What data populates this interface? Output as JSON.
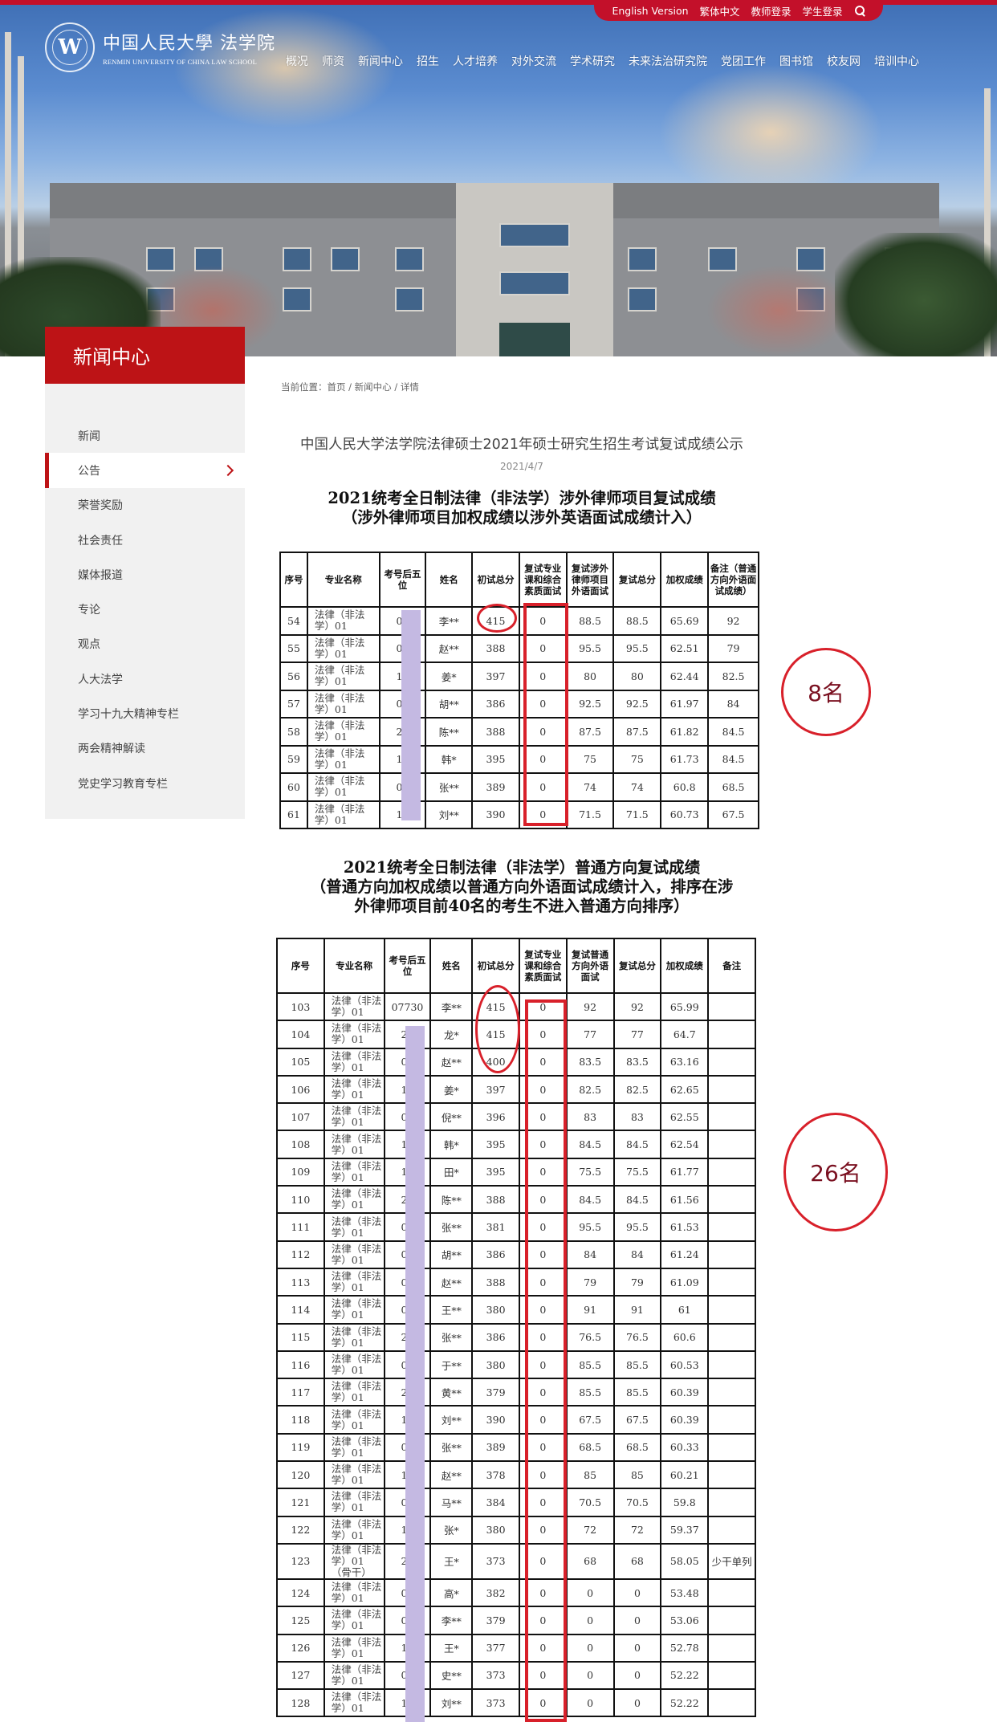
{
  "topbar": {
    "links": [
      "English Version",
      "繁体中文",
      "教师登录",
      "学生登录"
    ],
    "search_icon": "search-icon"
  },
  "logo": {
    "seal_letter": "W",
    "name_cn": "中国人民大學 法学院",
    "name_en": "RENMIN UNIVERSITY OF CHINA LAW SCHOOL"
  },
  "nav": {
    "items": [
      "概况",
      "师资",
      "新闻中心",
      "招生",
      "人才培养",
      "对外交流",
      "学术研究",
      "未来法治研究院",
      "党团工作",
      "图书馆",
      "校友网",
      "培训中心"
    ]
  },
  "sidebar": {
    "title": "新闻中心",
    "active_index": 1,
    "items": [
      "新闻",
      "公告",
      "荣誉奖励",
      "社会责任",
      "媒体报道",
      "专论",
      "观点",
      "人大法学",
      "学习十九大精神专栏",
      "两会精神解读",
      "党史学习教育专栏"
    ]
  },
  "breadcrumb": {
    "text": "当前位置：首页 / 新闻中心 / 详情"
  },
  "article": {
    "title": "中国人民大学法学院法律硕士2021年硕士研究生招生考试复试成绩公示",
    "date": "2021/4/7"
  },
  "table1": {
    "title_line1": "2021统考全日制法律（非法学）涉外律师项目复试成绩",
    "title_line2": "（涉外律师项目加权成绩以涉外英语面试成绩计入）",
    "headers": [
      "序号",
      "专业名称",
      "考号后五位",
      "姓名",
      "初试总分",
      "复试专业课和综合素质面试",
      "复试涉外律师项目外语面试",
      "复试总分",
      "加权成绩",
      "备注（普通方向外语面试成绩）"
    ],
    "rows": [
      [
        "54",
        "法律（非法学）01",
        "07",
        "李**",
        "415",
        "0",
        "88.5",
        "88.5",
        "65.69",
        "92"
      ],
      [
        "55",
        "法律（非法学）01",
        "07",
        "赵**",
        "388",
        "0",
        "95.5",
        "95.5",
        "62.51",
        "79"
      ],
      [
        "56",
        "法律（非法学）01",
        "13",
        "姜*",
        "397",
        "0",
        "80",
        "80",
        "62.44",
        "82.5"
      ],
      [
        "57",
        "法律（非法学）01",
        "07",
        "胡**",
        "386",
        "0",
        "92.5",
        "92.5",
        "61.97",
        "84"
      ],
      [
        "58",
        "法律（非法学）01",
        "20",
        "陈**",
        "388",
        "0",
        "87.5",
        "87.5",
        "61.82",
        "84.5"
      ],
      [
        "59",
        "法律（非法学）01",
        "12",
        "韩*",
        "395",
        "0",
        "75",
        "75",
        "61.73",
        "84.5"
      ],
      [
        "60",
        "法律（非法学）01",
        "09",
        "张**",
        "389",
        "0",
        "74",
        "74",
        "60.8",
        "68.5"
      ],
      [
        "61",
        "法律（非法学）01",
        "17",
        "刘**",
        "390",
        "0",
        "71.5",
        "71.5",
        "60.73",
        "67.5"
      ]
    ],
    "annotation": "8名"
  },
  "table2": {
    "title_line1": "2021统考全日制法律（非法学）普通方向复试成绩",
    "title_line2": "（普通方向加权成绩以普通方向外语面试成绩计入，排序在涉",
    "title_line3": "外律师项目前40名的考生不进入普通方向排序）",
    "headers": [
      "序号",
      "专业名称",
      "考号后五位",
      "姓名",
      "初试总分",
      "复试专业课和综合素质面试",
      "复试普通方向外语面试",
      "复试总分",
      "加权成绩",
      "备注"
    ],
    "rows": [
      [
        "103",
        "法律（非法学）01",
        "07730",
        "李**",
        "415",
        "0",
        "92",
        "92",
        "65.99",
        ""
      ],
      [
        "104",
        "法律（非法学）01",
        "23",
        "龙*",
        "415",
        "0",
        "77",
        "77",
        "64.7",
        ""
      ],
      [
        "105",
        "法律（非法学）01",
        "09",
        "赵**",
        "400",
        "0",
        "83.5",
        "83.5",
        "63.16",
        ""
      ],
      [
        "106",
        "法律（非法学）01",
        "13",
        "姜*",
        "397",
        "0",
        "82.5",
        "82.5",
        "62.65",
        ""
      ],
      [
        "107",
        "法律（非法学）01",
        "07",
        "倪**",
        "396",
        "0",
        "83",
        "83",
        "62.55",
        ""
      ],
      [
        "108",
        "法律（非法学）01",
        "12",
        "韩*",
        "395",
        "0",
        "84.5",
        "84.5",
        "62.54",
        ""
      ],
      [
        "109",
        "法律（非法学）01",
        "17",
        "田*",
        "395",
        "0",
        "75.5",
        "75.5",
        "61.77",
        ""
      ],
      [
        "110",
        "法律（非法学）01",
        "20",
        "陈**",
        "388",
        "0",
        "84.5",
        "84.5",
        "61.56",
        ""
      ],
      [
        "111",
        "法律（非法学）01",
        "07",
        "张**",
        "381",
        "0",
        "95.5",
        "95.5",
        "61.53",
        ""
      ],
      [
        "112",
        "法律（非法学）01",
        "07",
        "胡**",
        "386",
        "0",
        "84",
        "84",
        "61.24",
        ""
      ],
      [
        "113",
        "法律（非法学）01",
        "07",
        "赵**",
        "388",
        "0",
        "79",
        "79",
        "61.09",
        ""
      ],
      [
        "114",
        "法律（非法学）01",
        "07",
        "王**",
        "380",
        "0",
        "91",
        "91",
        "61",
        ""
      ],
      [
        "115",
        "法律（非法学）01",
        "24",
        "张**",
        "386",
        "0",
        "76.5",
        "76.5",
        "60.6",
        ""
      ],
      [
        "116",
        "法律（非法学）01",
        "08",
        "于**",
        "380",
        "0",
        "85.5",
        "85.5",
        "60.53",
        ""
      ],
      [
        "117",
        "法律（非法学）01",
        "20",
        "黄**",
        "379",
        "0",
        "85.5",
        "85.5",
        "60.39",
        ""
      ],
      [
        "118",
        "法律（非法学）01",
        "17",
        "刘**",
        "390",
        "0",
        "67.5",
        "67.5",
        "60.39",
        ""
      ],
      [
        "119",
        "法律（非法学）01",
        "09",
        "张**",
        "389",
        "0",
        "68.5",
        "68.5",
        "60.33",
        ""
      ],
      [
        "120",
        "法律（非法学）01",
        "17",
        "赵**",
        "378",
        "0",
        "85",
        "85",
        "60.21",
        ""
      ],
      [
        "121",
        "法律（非法学）01",
        "07",
        "马**",
        "384",
        "0",
        "70.5",
        "70.5",
        "59.8",
        ""
      ],
      [
        "122",
        "法律（非法学）01",
        "18",
        "张*",
        "380",
        "0",
        "72",
        "72",
        "59.37",
        ""
      ],
      [
        "123",
        "法律（非法学）01（骨干）",
        "24",
        "王*",
        "373",
        "0",
        "68",
        "68",
        "58.05",
        "少干单列"
      ],
      [
        "124",
        "法律（非法学）01",
        "07",
        "高*",
        "382",
        "0",
        "0",
        "0",
        "53.48",
        ""
      ],
      [
        "125",
        "法律（非法学）01",
        "07",
        "李**",
        "379",
        "0",
        "0",
        "0",
        "53.06",
        ""
      ],
      [
        "126",
        "法律（非法学）01",
        "10",
        "王*",
        "377",
        "0",
        "0",
        "0",
        "52.78",
        ""
      ],
      [
        "127",
        "法律（非法学）01",
        "07",
        "史**",
        "373",
        "0",
        "0",
        "0",
        "52.22",
        ""
      ],
      [
        "128",
        "法律（非法学）01",
        "17",
        "刘**",
        "373",
        "0",
        "0",
        "0",
        "52.22",
        ""
      ]
    ],
    "annotation": "26名"
  },
  "colors": {
    "brand_red": "#c3102a",
    "sidebar_red": "#bd1316",
    "annotation_red": "#d8202a",
    "redaction": "#c4b9e2"
  }
}
